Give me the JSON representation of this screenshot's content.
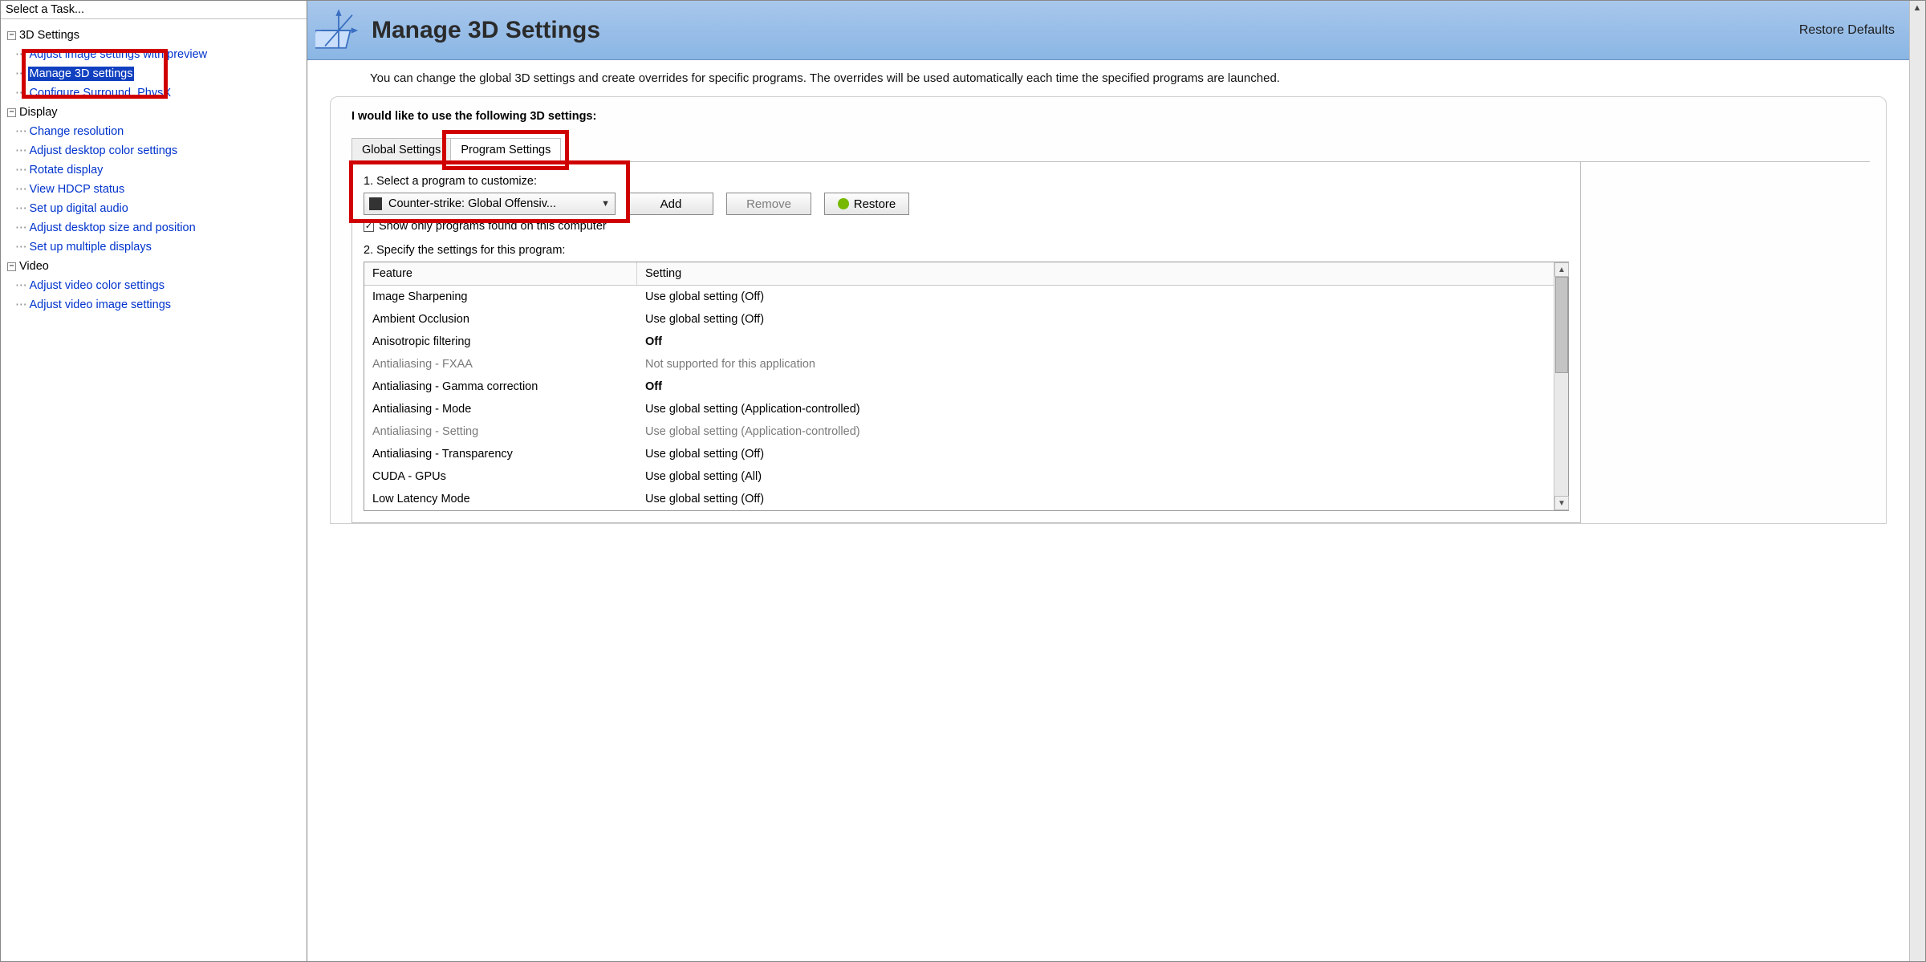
{
  "left": {
    "header": "Select a Task...",
    "groups": [
      {
        "label": "3D Settings",
        "items": [
          "Adjust image settings with preview",
          "Manage 3D settings",
          "Configure Surround, PhysX"
        ],
        "selectedIndex": 1
      },
      {
        "label": "Display",
        "items": [
          "Change resolution",
          "Adjust desktop color settings",
          "Rotate display",
          "View HDCP status",
          "Set up digital audio",
          "Adjust desktop size and position",
          "Set up multiple displays"
        ]
      },
      {
        "label": "Video",
        "items": [
          "Adjust video color settings",
          "Adjust video image settings"
        ]
      }
    ]
  },
  "banner": {
    "title": "Manage 3D Settings",
    "restore": "Restore Defaults"
  },
  "intro": "You can change the global 3D settings and create overrides for specific programs. The overrides will be used automatically each time the specified programs are launched.",
  "panel": {
    "heading": "I would like to use the following 3D settings:",
    "tabs": {
      "global": "Global Settings",
      "program": "Program Settings"
    },
    "step1": "1. Select a program to customize:",
    "selectedProgram": "Counter-strike: Global Offensiv...",
    "addBtn": "Add",
    "removeBtn": "Remove",
    "restoreBtn": "Restore",
    "showOnly": "Show only programs found on this computer",
    "step2": "2. Specify the settings for this program:",
    "columns": {
      "feature": "Feature",
      "setting": "Setting"
    },
    "rows": [
      {
        "f": "Image Sharpening",
        "s": "Use global setting (Off)"
      },
      {
        "f": "Ambient Occlusion",
        "s": "Use global setting (Off)"
      },
      {
        "f": "Anisotropic filtering",
        "s": "Off",
        "bold": true
      },
      {
        "f": "Antialiasing - FXAA",
        "s": "Not supported for this application",
        "dim": true
      },
      {
        "f": "Antialiasing - Gamma correction",
        "s": "Off",
        "bold": true
      },
      {
        "f": "Antialiasing - Mode",
        "s": "Use global setting (Application-controlled)"
      },
      {
        "f": "Antialiasing - Setting",
        "s": "Use global setting (Application-controlled)",
        "dim": true
      },
      {
        "f": "Antialiasing - Transparency",
        "s": "Use global setting (Off)"
      },
      {
        "f": "CUDA - GPUs",
        "s": "Use global setting (All)"
      },
      {
        "f": "Low Latency Mode",
        "s": "Use global setting (Off)"
      }
    ]
  }
}
